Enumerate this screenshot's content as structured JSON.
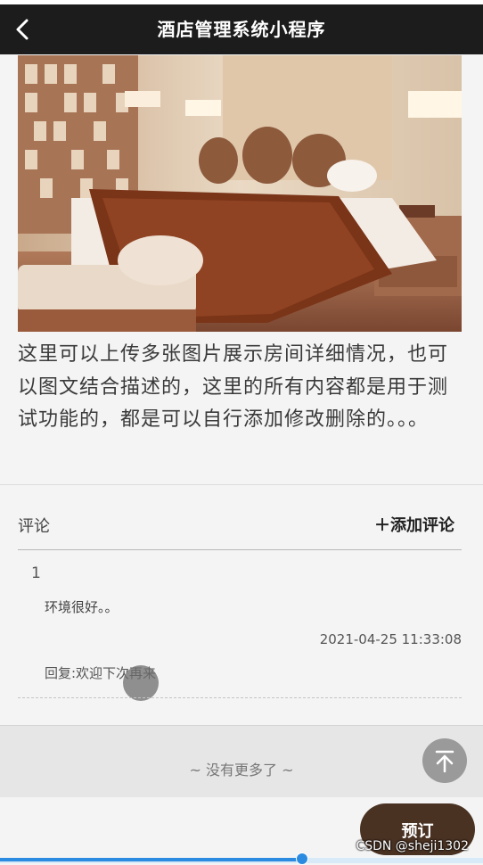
{
  "nav": {
    "title": "酒店管理系统小程序",
    "back_icon": "chevron-left-icon"
  },
  "room": {
    "photo": "hotel-room-photo",
    "description": "这里可以上传多张图片展示房间详细情况，也可以图文结合描述的，这里的所有内容都是用于测试功能的，都是可以自行添加修改删除的。。。"
  },
  "comments": {
    "label": "评论",
    "add_label": "＋添加评论",
    "items": [
      {
        "index": "1",
        "text": "环境很好。。",
        "time": "2021-04-25 11:33:08",
        "reply": "回复:欢迎下次再来"
      }
    ]
  },
  "footer": {
    "no_more": "~ 没有更多了 ~",
    "top_icon": "arrow-up-icon"
  },
  "book": {
    "label": "预订"
  },
  "watermark": "CSDN @sheji1302",
  "progress": {
    "value": 0.625
  },
  "colors": {
    "navbar": "#1c1c1c",
    "book_button": "#4a3222",
    "progress": "#2a8be0"
  }
}
